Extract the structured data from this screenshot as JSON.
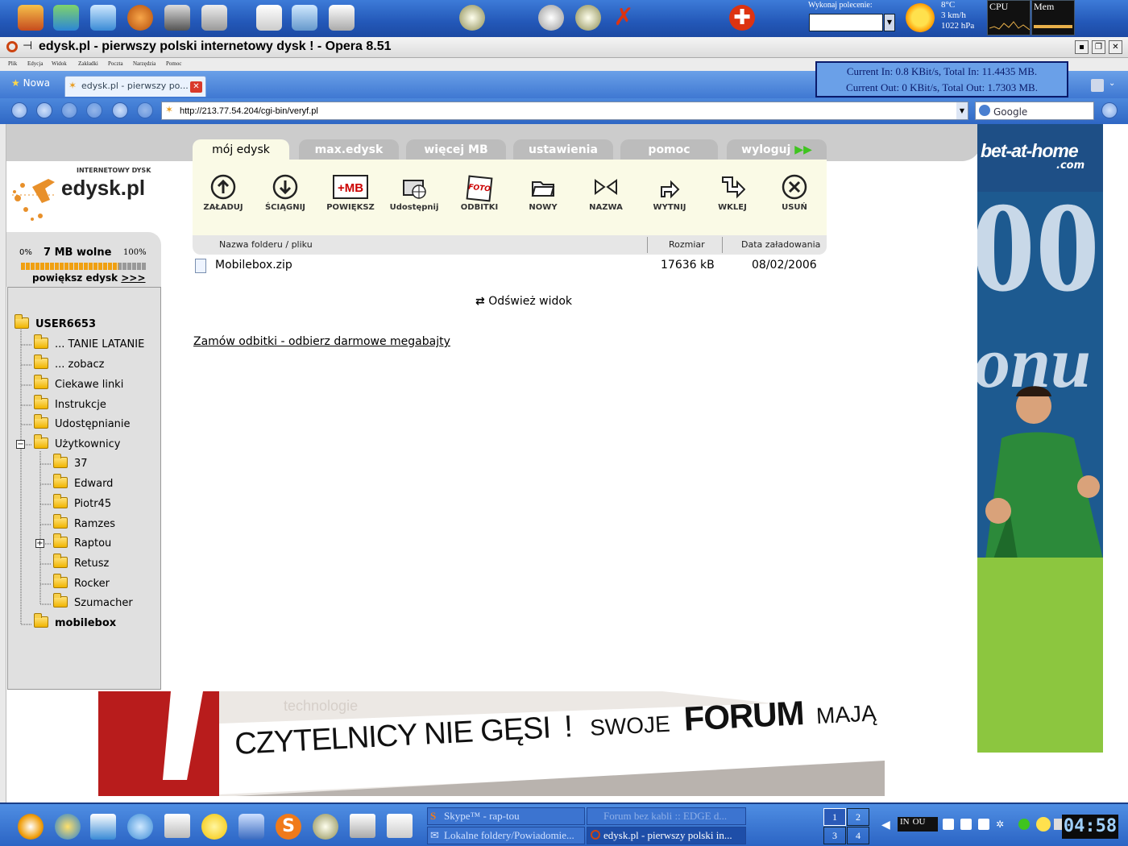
{
  "system_bar": {
    "run_label": "Wykonaj polecenie:",
    "weather": [
      "8°C",
      "3 km/h",
      "1022 hPa"
    ],
    "cpu_label": "CPU",
    "mem_label": "Mem"
  },
  "window": {
    "title": "edysk.pl - pierwszy polski internetowy dysk ! - Opera 8.51",
    "menu": [
      "Plik",
      "Edycja",
      "Widok",
      "Zakładki",
      "Poczta",
      "Narzędzia",
      "Pomoc"
    ]
  },
  "tabs": {
    "new_tab": "Nowa",
    "page_tab": "edysk.pl - pierwszy po..."
  },
  "netstats": {
    "line_in": "Current In: 0.8 KBit/s, Total In: 11.4435 MB.",
    "line_out": "Current Out: 0 KBit/s, Total Out: 1.7303 MB."
  },
  "address": {
    "url": "http://213.77.54.204/cgi-bin/veryf.pl",
    "search": "Google"
  },
  "site": {
    "logo_sub": "INTERNETOWY DYSK",
    "logo": "edysk.pl",
    "quota": {
      "min": "0%",
      "free": "7 MB wolne",
      "max": "100%",
      "used_fraction": 0.78,
      "enlarge": "powiększ edysk",
      "enlarge_arrow": ">>>"
    },
    "nav_tabs": [
      "mój edysk",
      "max.edysk",
      "więcej MB",
      "ustawienia",
      "pomoc",
      "wyloguj"
    ],
    "tools": [
      "ZAŁADUJ",
      "ŚCIĄGNIJ",
      "POWIĘKSZ",
      "Udostępnij",
      "ODBITKI",
      "NOWY",
      "NAZWA",
      "WYTNIJ",
      "WKLEJ",
      "USUŃ"
    ],
    "tool_icon_texts": {
      "mb": "+MB",
      "foto": "FOTO"
    },
    "columns": {
      "name": "Nazwa folderu / pliku",
      "size": "Rozmiar",
      "date": "Data załadowania"
    },
    "files": [
      {
        "name": "Mobilebox.zip",
        "size": "17636 kB",
        "date": "08/02/2006"
      }
    ],
    "refresh": "Odśwież widok",
    "promo_link": "Zamów odbitki - odbierz darmowe megabajty",
    "tree": {
      "root": "USER6653",
      "items": [
        "... TANIE LATANIE",
        "... zobacz",
        "Ciekawe linki",
        "Instrukcje",
        "Udostępnianie",
        "Użytkownicy"
      ],
      "users": [
        "37",
        "Edward",
        "Piotr45",
        "Ramzes",
        "Raptou",
        "Retusz",
        "Rocker",
        "Szumacher"
      ],
      "last": "mobilebox"
    },
    "ad_right": {
      "brand": "bet-at-home",
      "brand_sub": ".com",
      "big": "00",
      "big2": "onu"
    },
    "ad_banner": {
      "faded": "technologie",
      "text1": "CZYTELNICY NIE GĘSI",
      "excl": "!",
      "text2": "SWOJE",
      "text3": "FORUM",
      "text4": "MAJĄ",
      "excl2": "!"
    }
  },
  "taskbar": {
    "tasks": [
      "Skype™ - rap-tou",
      "Forum bez kabli :: EDGE d...",
      "Lokalne foldery/Powiadomie...",
      "edysk.pl - pierwszy polski in..."
    ],
    "pager": [
      "1",
      "2",
      "3",
      "4"
    ],
    "tray_in": "IN",
    "tray_out": "OU",
    "clock": "04:58"
  }
}
